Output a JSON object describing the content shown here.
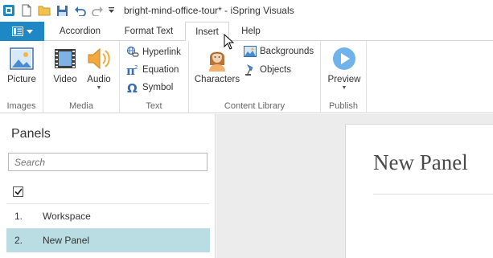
{
  "window": {
    "title": "bright-mind-office-tour* - iSpring Visuals"
  },
  "quick_access": {
    "icons": [
      "app-logo-icon",
      "new-document-icon",
      "open-folder-icon",
      "save-icon",
      "undo-icon",
      "redo-icon",
      "customize-icon"
    ]
  },
  "ribbon_tabs": [
    {
      "label": "Accordion"
    },
    {
      "label": "Format Text"
    },
    {
      "label": "Insert",
      "active": true
    },
    {
      "label": "Help"
    }
  ],
  "ribbon": {
    "images": {
      "group_label": "Images",
      "picture_label": "Picture"
    },
    "media": {
      "group_label": "Media",
      "video_label": "Video",
      "audio_label": "Audio"
    },
    "text": {
      "group_label": "Text",
      "hyperlink_label": "Hyperlink",
      "equation_label": "Equation",
      "symbol_label": "Symbol"
    },
    "content_library": {
      "group_label": "Content Library",
      "characters_label": "Characters",
      "backgrounds_label": "Backgrounds",
      "objects_label": "Objects"
    },
    "publish": {
      "group_label": "Publish",
      "preview_label": "Preview"
    }
  },
  "sidebar": {
    "title": "Panels",
    "search_placeholder": "Search",
    "select_all_checked": true,
    "items": [
      {
        "number": "1.",
        "name": "Workspace",
        "selected": false
      },
      {
        "number": "2.",
        "name": "New Panel",
        "selected": true
      }
    ]
  },
  "canvas": {
    "panel_title": "New Panel"
  },
  "colors": {
    "accent": "#1e87c6",
    "selected_row": "#b9dde3",
    "canvas_bg": "#ececec"
  }
}
